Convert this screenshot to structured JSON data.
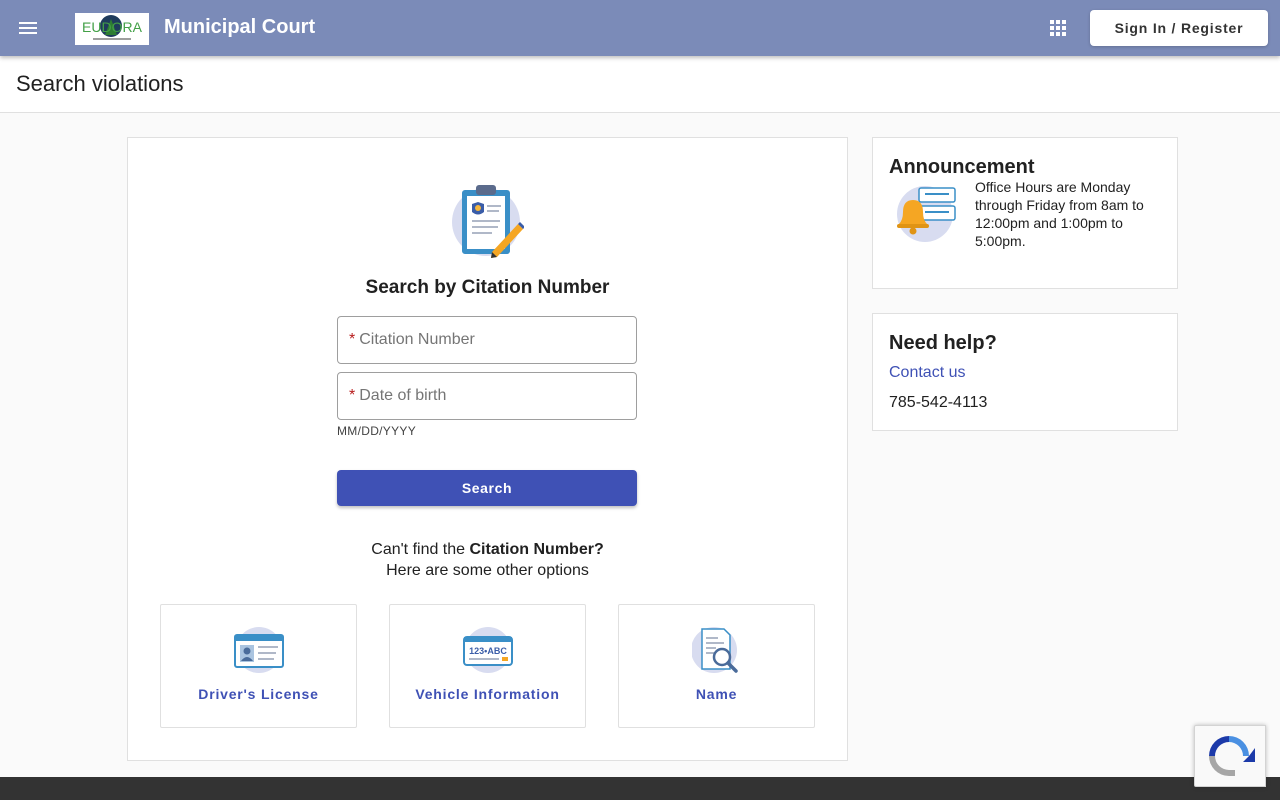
{
  "header": {
    "menu_icon": "hamburger-menu-icon",
    "logo_text": "EUDORA",
    "app_title": "Municipal Court",
    "apps_icon": "apps-grid-icon",
    "sign_in_label": "Sign In / Register",
    "bar_color": "#7b8bb8"
  },
  "page": {
    "title": "Search violations"
  },
  "search_form": {
    "hero_icon": "clipboard-pen-icon",
    "title": "Search by Citation Number",
    "required_mark": "*",
    "citation_label": "Citation Number",
    "dob_label": "Date of birth",
    "dob_hint": "MM/DD/YYYY",
    "search_label": "Search",
    "alt_prefix": "Can't find the ",
    "alt_bold": "Citation Number?",
    "alt_line2": "Here are some other options",
    "options": [
      {
        "label": "Driver's License",
        "icon": "id-card-icon"
      },
      {
        "label": "Vehicle Information",
        "icon": "license-plate-icon",
        "plate_text": "123•ABC"
      },
      {
        "label": "Name",
        "icon": "document-search-icon"
      }
    ],
    "accent_color": "#3f51b5"
  },
  "announcement": {
    "title": "Announcement",
    "icon": "bell-notification-icon",
    "text": "Office Hours are Monday through Friday from 8am to 12:00pm and 1:00pm to 5:00pm."
  },
  "help": {
    "title": "Need help?",
    "contact_label": "Contact us",
    "phone": "785-542-4113"
  },
  "recaptcha": {
    "icon": "recaptcha-icon"
  }
}
